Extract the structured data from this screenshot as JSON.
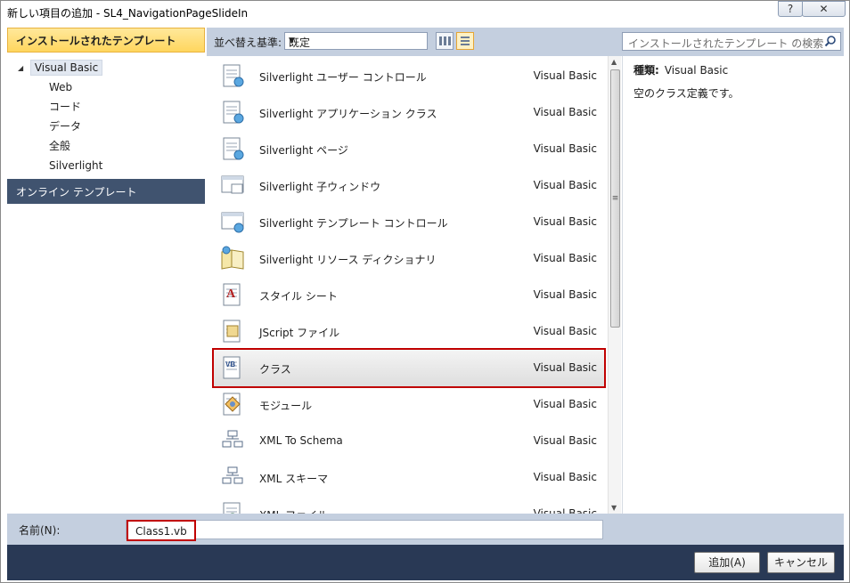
{
  "window": {
    "title": "新しい項目の追加 - SL4_NavigationPageSlideIn",
    "help": "?",
    "close": "✕"
  },
  "left": {
    "header": "インストールされたテンプレート",
    "root": "Visual Basic",
    "children": [
      "Web",
      "コード",
      "データ",
      "全般",
      "Silverlight"
    ],
    "online": "オンライン テンプレート"
  },
  "toolbar": {
    "sort_label": "並べ替え基準:",
    "sort_value": "既定",
    "search_placeholder": "インストールされたテンプレート の検索"
  },
  "items": [
    {
      "name": "Silverlight ユーザー コントロール",
      "type": "Visual Basic",
      "icon": "user-control-icon"
    },
    {
      "name": "Silverlight アプリケーション クラス",
      "type": "Visual Basic",
      "icon": "app-class-icon"
    },
    {
      "name": "Silverlight ページ",
      "type": "Visual Basic",
      "icon": "page-icon"
    },
    {
      "name": "Silverlight 子ウィンドウ",
      "type": "Visual Basic",
      "icon": "child-window-icon"
    },
    {
      "name": "Silverlight テンプレート コントロール",
      "type": "Visual Basic",
      "icon": "templated-control-icon"
    },
    {
      "name": "Silverlight リソース ディクショナリ",
      "type": "Visual Basic",
      "icon": "resource-dictionary-icon"
    },
    {
      "name": "スタイル シート",
      "type": "Visual Basic",
      "icon": "stylesheet-icon"
    },
    {
      "name": "JScript ファイル",
      "type": "Visual Basic",
      "icon": "jscript-icon"
    },
    {
      "name": "クラス",
      "type": "Visual Basic",
      "icon": "class-icon",
      "selected": true
    },
    {
      "name": "モジュール",
      "type": "Visual Basic",
      "icon": "module-icon"
    },
    {
      "name": "XML To Schema",
      "type": "Visual Basic",
      "icon": "xml-schema-icon"
    },
    {
      "name": "XML スキーマ",
      "type": "Visual Basic",
      "icon": "xml-schema-icon"
    },
    {
      "name": "XML ファイル",
      "type": "Visual Basic",
      "icon": "xml-file-icon"
    }
  ],
  "details": {
    "kind_label": "種類:",
    "kind_value": "Visual Basic",
    "description": "空のクラス定義です。"
  },
  "bottom": {
    "name_label": "名前(N):",
    "name_value": "Class1.vb",
    "add": "追加(A)",
    "cancel": "キャンセル"
  }
}
